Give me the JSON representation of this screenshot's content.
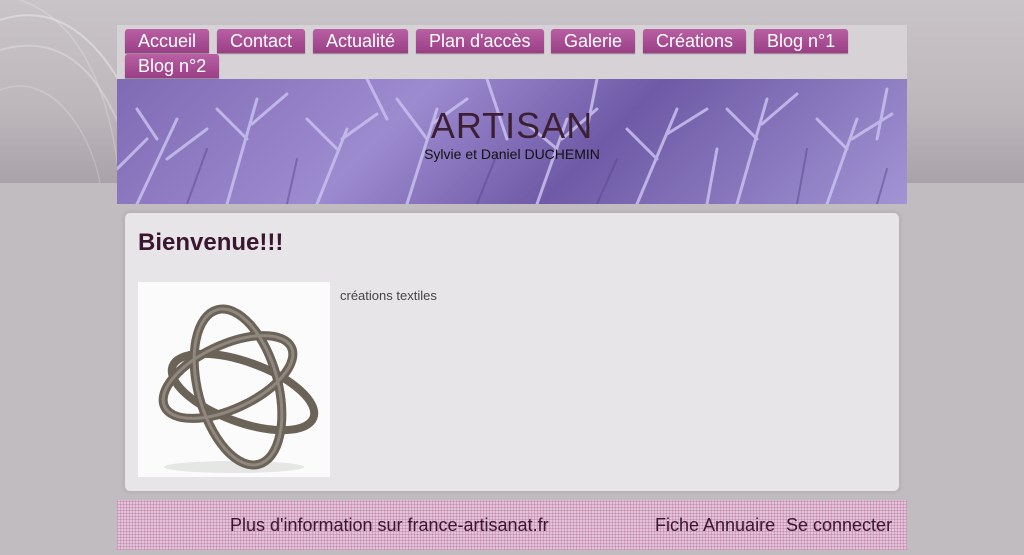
{
  "nav": {
    "items": [
      {
        "label": "Accueil"
      },
      {
        "label": "Contact"
      },
      {
        "label": "Actualité"
      },
      {
        "label": "Plan d'accès"
      },
      {
        "label": "Galerie"
      },
      {
        "label": "Créations"
      },
      {
        "label": "Blog n°1"
      },
      {
        "label": "Blog n°2"
      }
    ]
  },
  "header": {
    "title": "ARTISAN",
    "subtitle": "Sylvie et Daniel DUCHEMIN"
  },
  "main": {
    "heading": "Bienvenue!!!",
    "caption": "créations textiles"
  },
  "footer": {
    "info_link": "Plus d'information sur france-artisanat.fr",
    "directory_link": "Fiche Annuaire",
    "login_link": "Se connecter"
  },
  "colors": {
    "nav_tab": "#a34a8e",
    "title_text": "#3d1f35",
    "footer_bg": "#e3c3d8"
  }
}
